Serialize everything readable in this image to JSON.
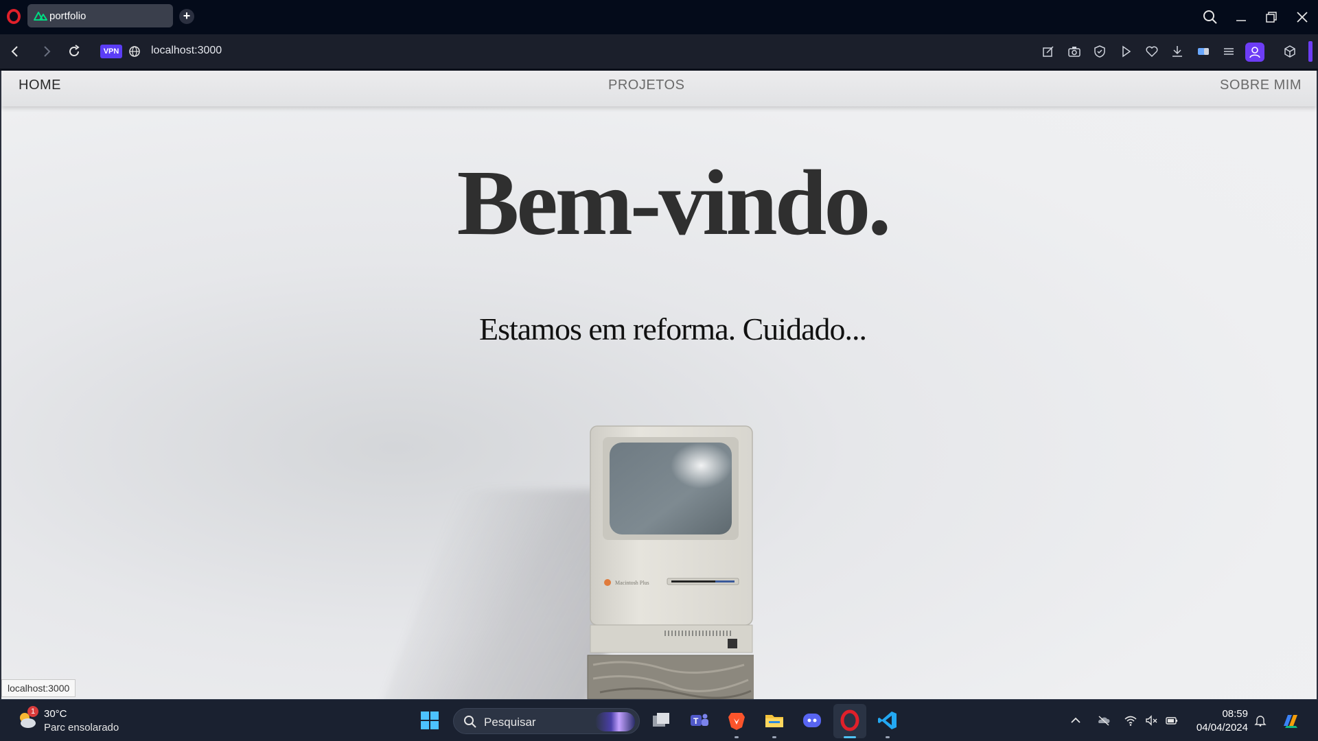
{
  "browser": {
    "tab": {
      "title": "portfolio",
      "favicon": "nuxt-icon"
    },
    "new_tab_icon": "plus-icon",
    "url": "localhost:3000",
    "vpn_badge": "VPN",
    "accent_color": "#6d3df5"
  },
  "site": {
    "nav": {
      "home": "HOME",
      "projects": "PROJETOS",
      "about": "SOBRE MIM"
    },
    "hero": {
      "title": "Bem-vindo.",
      "subtitle": "Estamos em reforma. Cuidado..."
    },
    "computer_label": "Macintosh Plus"
  },
  "status_bar": {
    "url": "localhost:3000"
  },
  "taskbar": {
    "weather": {
      "temperature": "30°C",
      "description": "Parc ensolarado",
      "badge": "1"
    },
    "search": {
      "label": "Pesquisar"
    },
    "apps": [
      "windows-start-icon",
      "task-view-icon",
      "teams-icon",
      "brave-icon",
      "file-explorer-icon",
      "discord-icon",
      "opera-icon",
      "vscode-icon"
    ],
    "clock": {
      "time": "08:59",
      "date": "04/04/2024"
    }
  }
}
